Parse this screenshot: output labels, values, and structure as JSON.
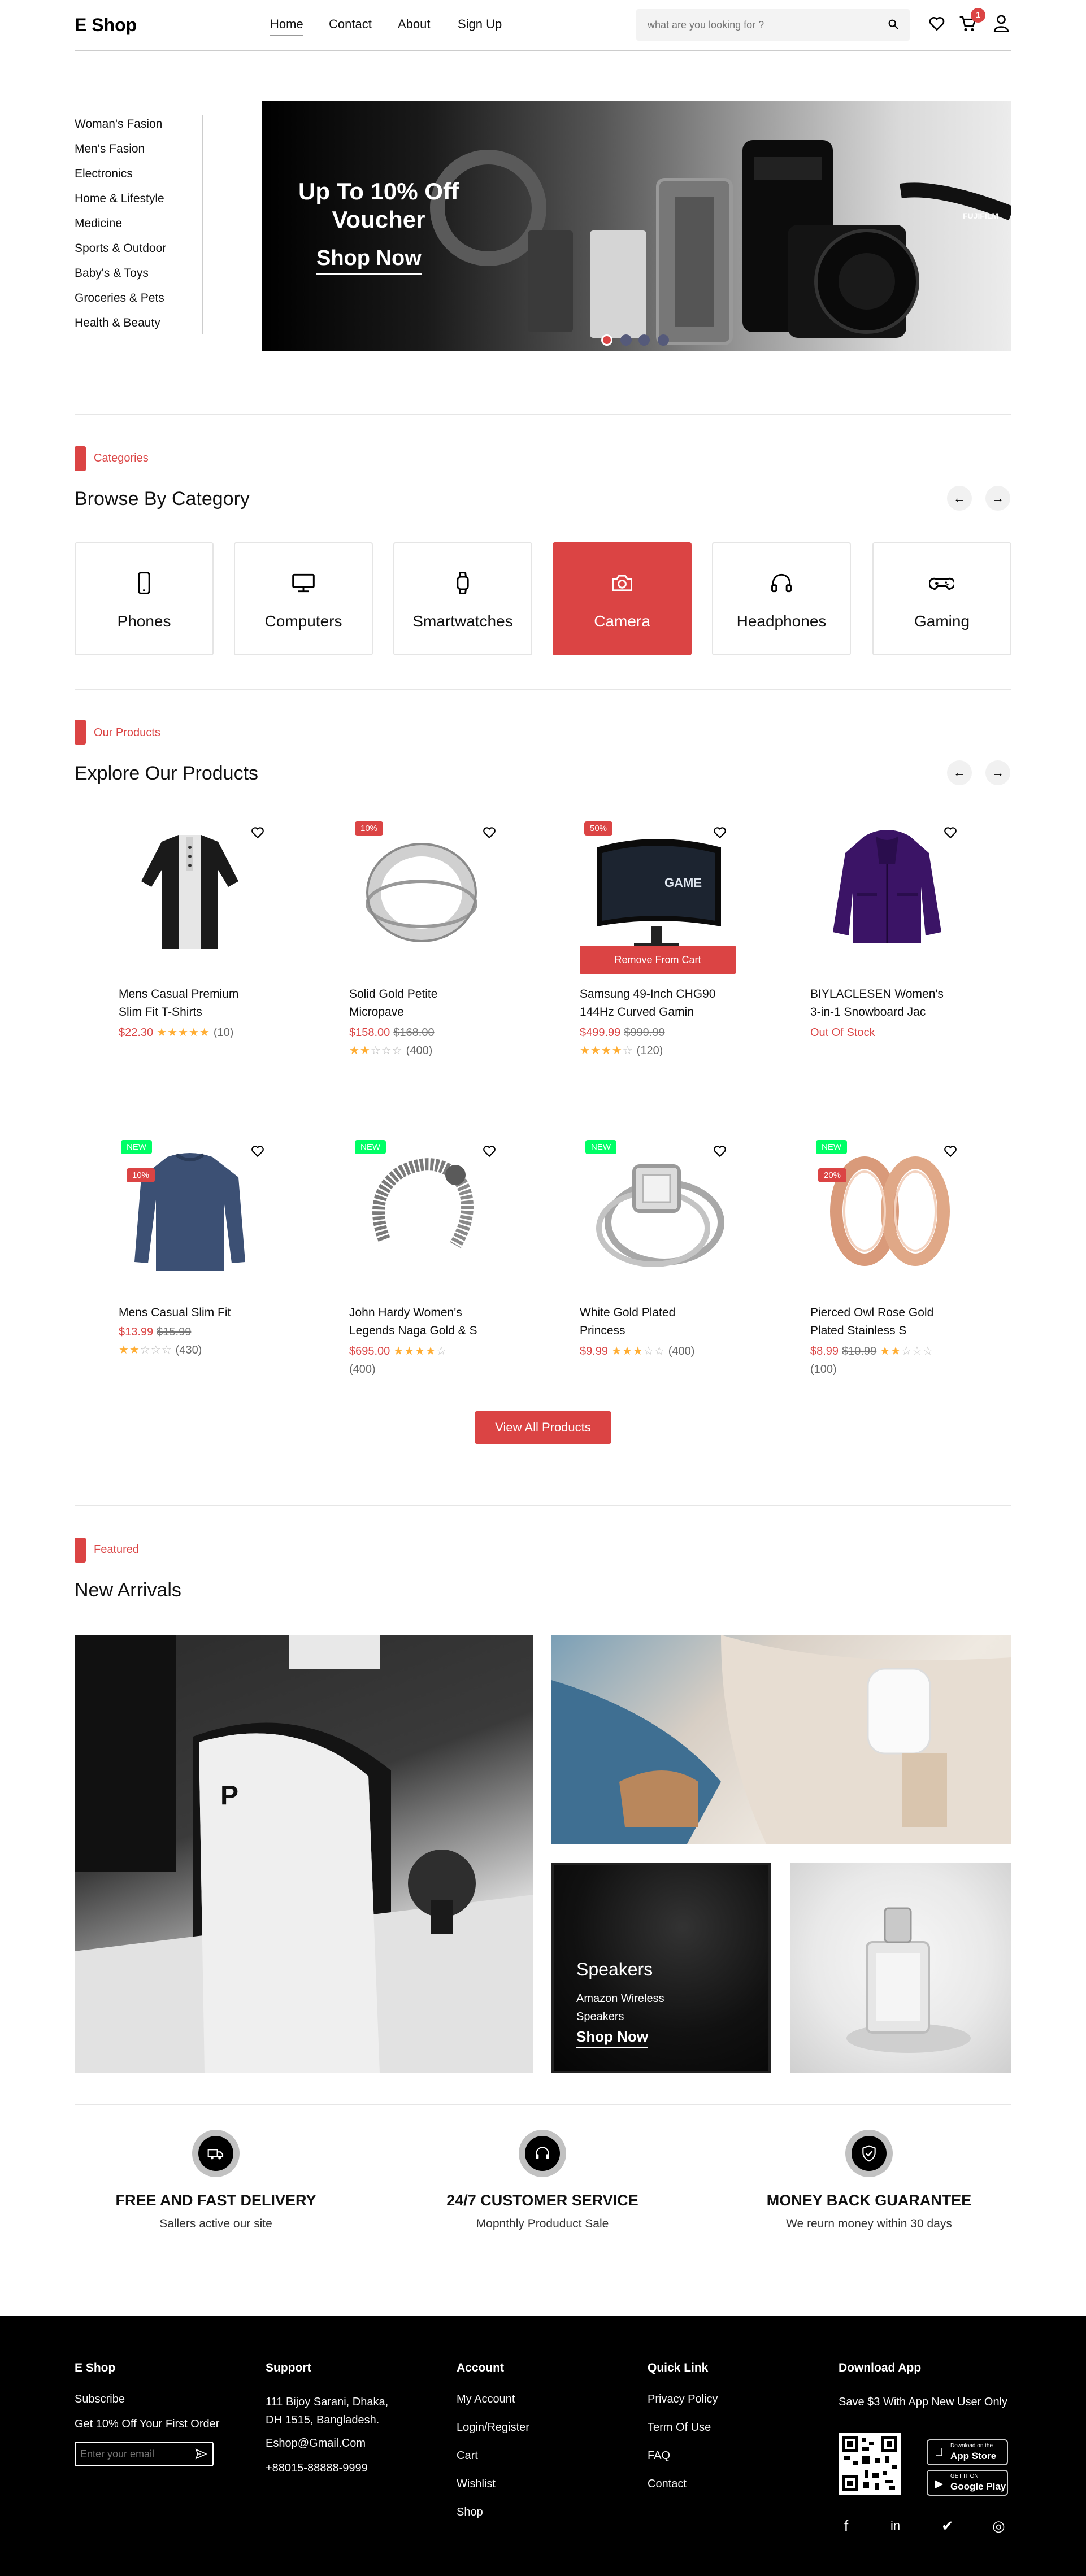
{
  "header": {
    "logo": "E Shop",
    "nav": [
      "Home",
      "Contact",
      "About",
      "Sign Up"
    ],
    "search_placeholder": "what are you looking for ?",
    "cart_count": "1"
  },
  "sidebar": {
    "items": [
      "Woman's Fasion",
      "Men's Fasion",
      "Electronics",
      "Home & Lifestyle",
      "Medicine",
      "Sports & Outdoor",
      "Baby's & Toys",
      "Groceries & Pets",
      "Health & Beauty"
    ]
  },
  "hero": {
    "title": "Up To 10% Off Voucher",
    "cta": "Shop Now",
    "brand_text": "FUJIFILM",
    "slides": 4,
    "active_slide": 1
  },
  "categories": {
    "tag": "Categories",
    "title": "Browse By Category",
    "items": [
      {
        "label": "Phones",
        "icon": "phone-icon"
      },
      {
        "label": "Computers",
        "icon": "monitor-icon"
      },
      {
        "label": "Smartwatches",
        "icon": "watch-icon"
      },
      {
        "label": "Camera",
        "icon": "camera-icon",
        "selected": true
      },
      {
        "label": "Headphones",
        "icon": "headphones-icon"
      },
      {
        "label": "Gaming",
        "icon": "gamepad-icon"
      }
    ]
  },
  "products": {
    "tag": "Our Products",
    "title": "Explore Our Products",
    "remove_label": "Remove From Cart",
    "view_all": "View All Products",
    "items": [
      {
        "name": "Mens Casual Premium Slim Fit T-Shirts",
        "price": "$22.30",
        "old": "",
        "rating": 5,
        "count": "(10)",
        "badge": "",
        "new": false
      },
      {
        "name": "Solid Gold Petite Micropave",
        "price": "$158.00",
        "old": "$168.00",
        "rating": 2,
        "count": "(400)",
        "badge": "10%",
        "new": false
      },
      {
        "name": "Samsung 49-Inch CHG90 144Hz Curved Gamin",
        "price": "$499.99",
        "old": "$999.99",
        "rating": 3.5,
        "count": "(120)",
        "badge": "50%",
        "new": false
      },
      {
        "name": "BIYLACLESEN Women's 3-in-1 Snowboard Jac",
        "price": "",
        "old": "",
        "rating": 0,
        "count": "",
        "badge": "",
        "new": false,
        "status": "Out Of Stock"
      },
      {
        "name": "Mens Casual Slim Fit",
        "price": "$13.99",
        "old": "$15.99",
        "rating": 2,
        "count": "(430)",
        "badge": "10%",
        "new": true
      },
      {
        "name": "John Hardy Women's Legends Naga Gold & S",
        "price": "$695.00",
        "old": "",
        "rating": 4.5,
        "count": "(400)",
        "badge": "",
        "new": true
      },
      {
        "name": "White Gold Plated Princess",
        "price": "$9.99",
        "old": "",
        "rating": 3,
        "count": "(400)",
        "badge": "",
        "new": true
      },
      {
        "name": "Pierced Owl Rose Gold Plated Stainless S",
        "price": "$8.99",
        "old": "$10.99",
        "rating": 2,
        "count": "(100)",
        "badge": "20%",
        "new": true
      }
    ]
  },
  "featured": {
    "tag": "Featured",
    "title": "New Arrivals",
    "speakers_title": "Speakers",
    "speakers_sub": "Amazon Wireless Speakers",
    "speakers_cta": "Shop Now"
  },
  "services": [
    {
      "title": "FREE AND FAST DELIVERY",
      "sub": "Sallers active our site",
      "icon": "truck-icon"
    },
    {
      "title": "24/7 CUSTOMER SERVICE",
      "sub": "Mopnthly Produduct Sale",
      "icon": "headset-icon"
    },
    {
      "title": "MONEY BACK GUARANTEE",
      "sub": "We reurn money within 30 days",
      "icon": "shield-check-icon"
    }
  ],
  "footer": {
    "brand": "E Shop",
    "subscribe": "Subscribe",
    "offer": "Get 10% Off Your First Order",
    "email_placeholder": "Enter your email",
    "support_title": "Support",
    "address": "111 Bijoy Sarani, Dhaka, DH 1515, Bangladesh.",
    "email": "Eshop@Gmail.Com",
    "phone": "+88015-88888-9999",
    "account_title": "Account",
    "account_links": [
      "My Account",
      "Login/Register",
      "Cart",
      "Wishlist",
      "Shop"
    ],
    "quick_title": "Quick Link",
    "quick_links": [
      "Privacy Policy",
      "Term Of Use",
      "FAQ",
      "Contact"
    ],
    "app_title": "Download App",
    "app_sub": "Save $3 With App New User Only",
    "appstore_small": "Download on the",
    "appstore": "App Store",
    "gplay_small": "GET IT ON",
    "gplay": "Google Play",
    "social": [
      "f",
      "in",
      "✔",
      "◎"
    ]
  }
}
